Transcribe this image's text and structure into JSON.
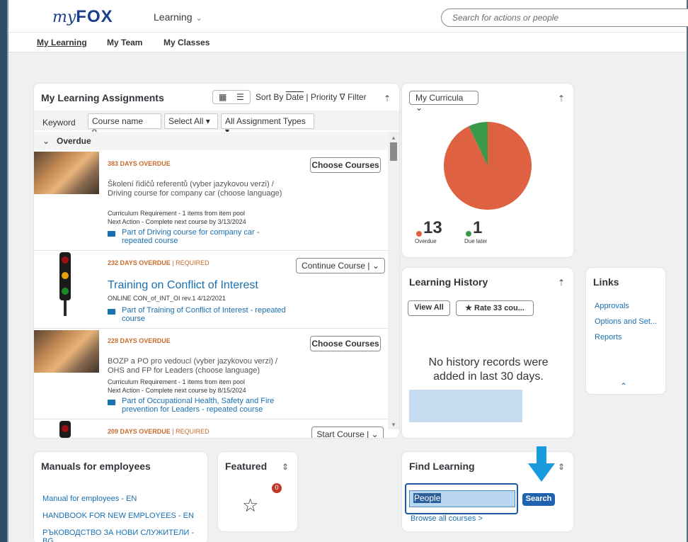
{
  "header": {
    "logo_my": "my",
    "logo_fox": "FOX",
    "module": "Learning",
    "search_placeholder": "Search for actions or people"
  },
  "subnav": {
    "tabs": [
      {
        "label": "My Learning"
      },
      {
        "label": "My Team"
      },
      {
        "label": "My Classes"
      }
    ]
  },
  "assignments": {
    "title": "My Learning Assignments",
    "sort_prefix": "Sort By",
    "sort_date": "Date",
    "sort_sep": "|",
    "sort_priority": "Priority",
    "filter": "Filter",
    "keyword_label": "Keyword",
    "keyword_placeholder": "Course name o...",
    "select_all": "Select All",
    "assignment_types": "All Assignment Types",
    "group": "Overdue",
    "items": [
      {
        "overdue": "383 DAYS OVERDUE",
        "title": "Školení řidičů referentů (vyber jazykovou verzi) / Driving course for company car (choose language)",
        "meta1": "Curriculum Requirement - 1 items from item pool",
        "meta2": "Next Action - Complete next course by 3/13/2024",
        "partof": "Part of Driving course for company car - repeated course",
        "button": "Choose Courses"
      },
      {
        "overdue": "232 DAYS OVERDUE",
        "required": "REQUIRED",
        "title": "Training on Conflict of Interest",
        "meta1": "ONLINE CON_of_INT_OI rev.1 4/12/2021",
        "partof": "Part of Training of Conflict of Interest - repeated course",
        "button": "Continue Course"
      },
      {
        "overdue": "228 DAYS OVERDUE",
        "title": "BOZP a PO pro vedoucí (vyber jazykovou verzi) / OHS and FP for Leaders (choose language)",
        "meta1": "Curriculum Requirement - 1 items from item pool",
        "meta2": "Next Action - Complete next course by 8/15/2024",
        "partof": "Part of Occupational Health, Safety and Fire prevention for Leaders - repeated course",
        "button": "Choose Courses"
      },
      {
        "overdue": "209 DAYS OVERDUE",
        "required": "REQUIRED",
        "button": "Start Course"
      }
    ]
  },
  "curricula": {
    "select": "My Curricula",
    "overdue_count": "13",
    "overdue_label": "Overdue",
    "due_later_count": "1",
    "due_later_label": "Due later",
    "color_overdue": "#de6241",
    "color_due_later": "#3a9a4a",
    "pie_fraction_overdue": 0.929
  },
  "history": {
    "title": "Learning History",
    "view_all": "View All",
    "rate": "Rate 33 cou...",
    "empty": "No history records were added in last 30 days."
  },
  "links": {
    "title": "Links",
    "items": [
      "Approvals",
      "Options and Set...",
      "Reports"
    ]
  },
  "manuals": {
    "title": "Manuals for employees",
    "items": [
      "Manual for employees - EN",
      "HANDBOOK FOR NEW EMPLOYEES - EN",
      "РЪКОВОДСТВО ЗА НОВИ СЛУЖИТЕЛИ - BG"
    ]
  },
  "featured": {
    "title": "Featured",
    "badge": "0"
  },
  "find": {
    "title": "Find Learning",
    "input_value": "People",
    "search_button": "Search",
    "browse": "Browse all courses >"
  },
  "colors": {
    "accent": "#1a6fb0",
    "overdue_text": "#c96b2b",
    "arrow": "#1a9be0"
  }
}
